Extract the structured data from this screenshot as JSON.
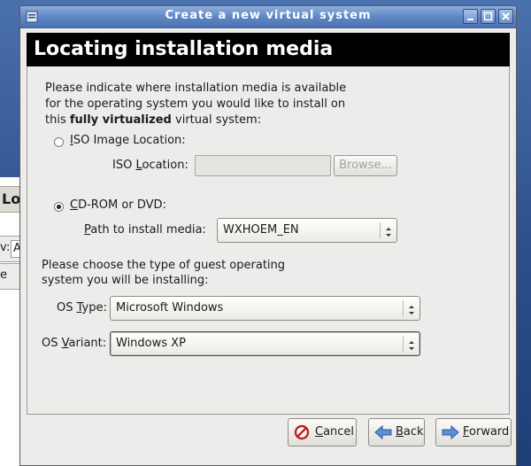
{
  "window": {
    "title": "Create a new virtual system",
    "header": "Locating installation media"
  },
  "background_window": {
    "title_fragment": "Loca",
    "row1_fragment": "v:",
    "row1_input_fragment": "A",
    "row2_fragment": "e"
  },
  "intro": {
    "line1": "Please indicate where installation media is available",
    "line2": "for the operating system you would like to install on",
    "line3_pre": "this ",
    "line3_bold": "fully virtualized",
    "line3_post": " virtual system:"
  },
  "iso": {
    "radio_label_mn": "I",
    "radio_label_rest": "SO Image Location:",
    "location_label_pre": "ISO ",
    "location_label_mn": "L",
    "location_label_rest": "ocation:",
    "location_value": "",
    "browse_label": "Browse..."
  },
  "cdrom": {
    "radio_label_mn": "C",
    "radio_label_rest": "D-ROM or DVD:",
    "path_label_mn": "P",
    "path_label_rest": "ath to install media:",
    "path_value": "WXHOEM_EN"
  },
  "os": {
    "choose_line1": "Please choose the type of guest operating",
    "choose_line2": "system you will be installing:",
    "type_label_pre": "OS ",
    "type_label_mn": "T",
    "type_label_rest": "ype:",
    "type_value": "Microsoft Windows",
    "variant_label_pre": "OS ",
    "variant_label_mn": "V",
    "variant_label_rest": "ariant:",
    "variant_value": "Windows XP"
  },
  "footer": {
    "cancel_mn": "C",
    "cancel_rest": "ancel",
    "back_mn": "B",
    "back_rest": "ack",
    "forward_mn": "F",
    "forward_rest": "orward"
  },
  "colors": {
    "titlebar": "#5f87c4",
    "header_bg": "#000000",
    "dialog_bg": "#edeceb"
  },
  "icons": [
    "window-menu-icon",
    "minimize-icon",
    "maximize-icon",
    "close-icon",
    "cancel-icon",
    "back-arrow-icon",
    "forward-arrow-icon",
    "combo-arrows-icon"
  ]
}
